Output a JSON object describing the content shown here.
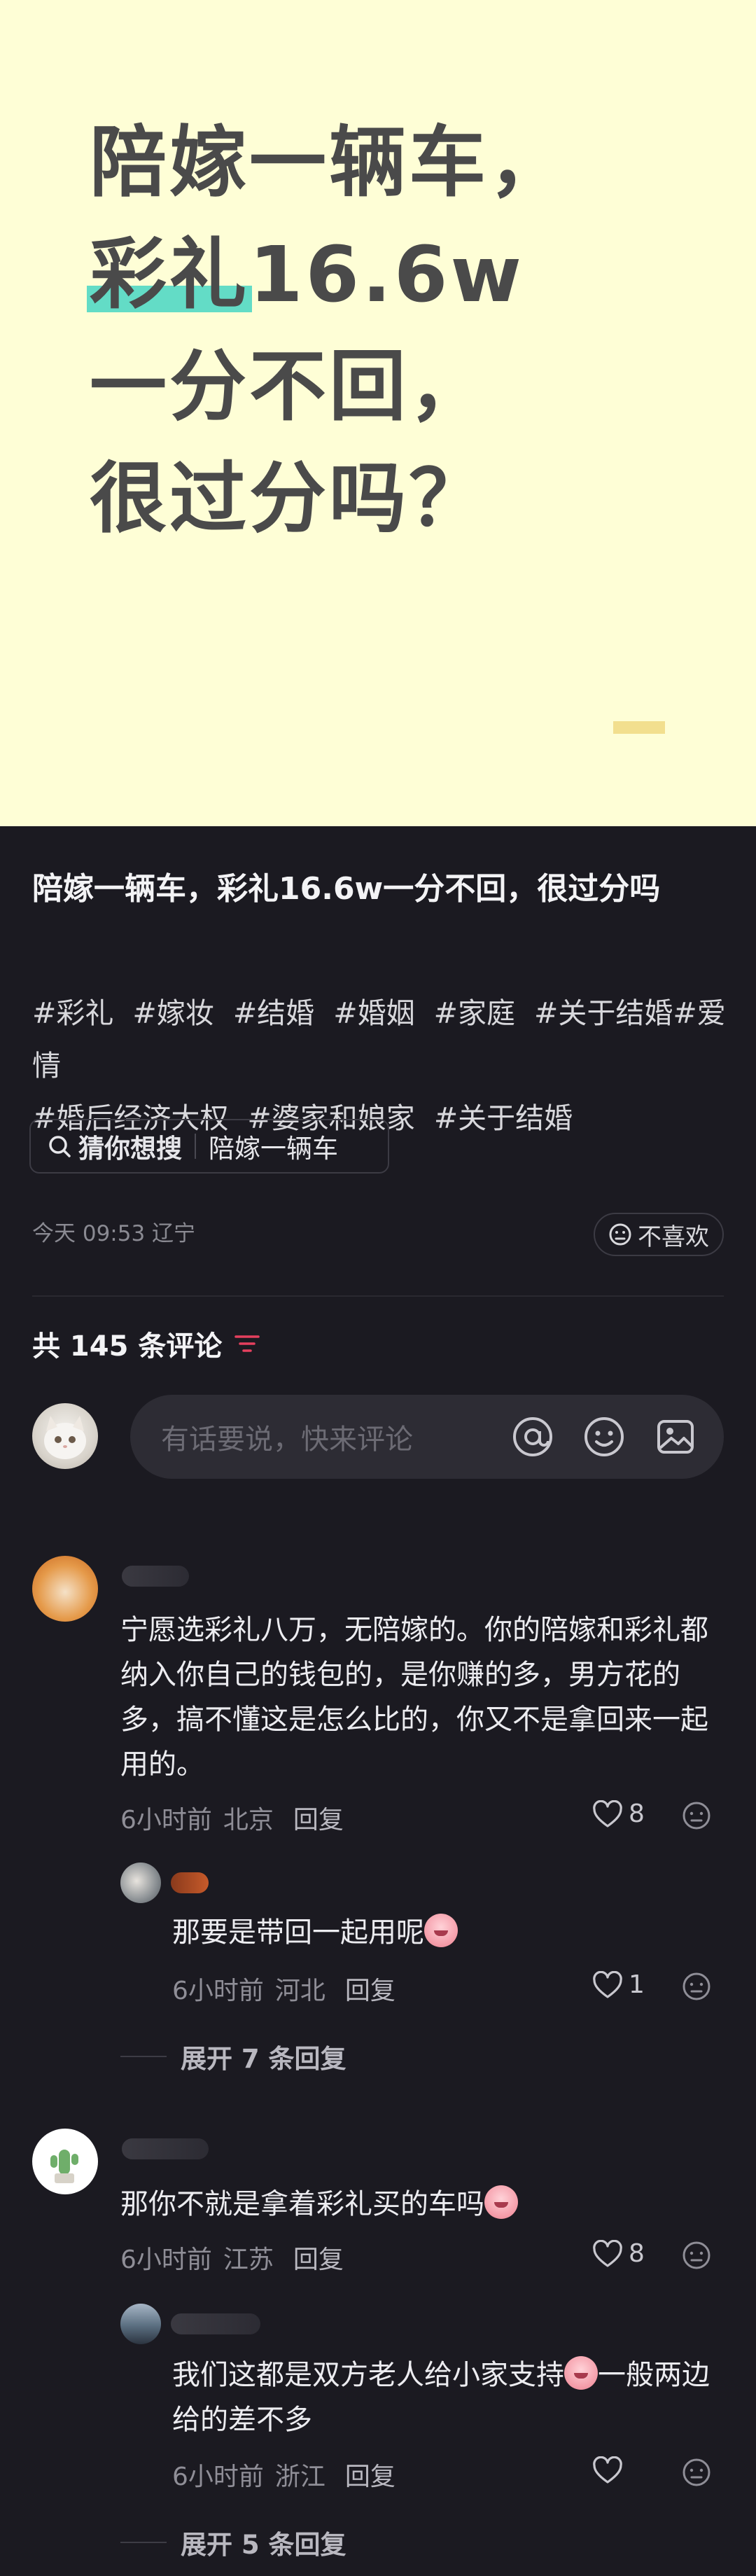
{
  "hero": {
    "line1": "陪嫁一辆车，",
    "line2_highlight": "彩礼",
    "line2_rest": "16.6w",
    "line3": "一分不回，",
    "line4": "很过分吗？"
  },
  "post": {
    "title": "陪嫁一辆车，彩礼16.6w一分不回，很过分吗",
    "tags": [
      "#彩礼",
      "#嫁妆",
      "#结婚",
      "#婚姻",
      "#家庭",
      "#关于结婚#爱情",
      "#婚后经济大权",
      "#婆家和娘家",
      "#关于结婚"
    ],
    "guess_label": "猜你想搜",
    "guess_query": "陪嫁一辆车",
    "meta": "今天 09:53 辽宁",
    "dislike": "不喜欢"
  },
  "comments_header": {
    "count": "共 145 条评论",
    "input_placeholder": "有话要说，快来评论",
    "icons": [
      "at-icon",
      "emoji-icon",
      "image-icon"
    ]
  },
  "comments": [
    {
      "text": "宁愿选彩礼八万，无陪嫁的。你的陪嫁和彩礼都纳入你自己的钱包的，是你赚的多，男方花的多，搞不懂这是怎么比的，你又不是拿回来一起用的。",
      "time": "6小时前",
      "location": "北京",
      "reply": "回复",
      "likes": "8",
      "replies": [
        {
          "text": "那要是带回一起用呢",
          "time": "6小时前",
          "location": "河北",
          "reply": "回复",
          "likes": "1"
        }
      ],
      "expand": "展开 7 条回复"
    },
    {
      "text": "那你不就是拿着彩礼买的车吗",
      "time": "6小时前",
      "location": "江苏",
      "reply": "回复",
      "likes": "8",
      "replies": [
        {
          "text_a": "我们这都是双方老人给小家支持",
          "text_b": "一般两边给的差不多",
          "time": "6小时前",
          "location": "浙江",
          "reply": "回复",
          "likes": ""
        }
      ],
      "expand": "展开 5 条回复"
    }
  ],
  "colors": {
    "hero_bg": "#fefed6",
    "highlight": "#63dcc6",
    "page_bg": "#1b1a21",
    "sort_icon": "#e5405e"
  }
}
